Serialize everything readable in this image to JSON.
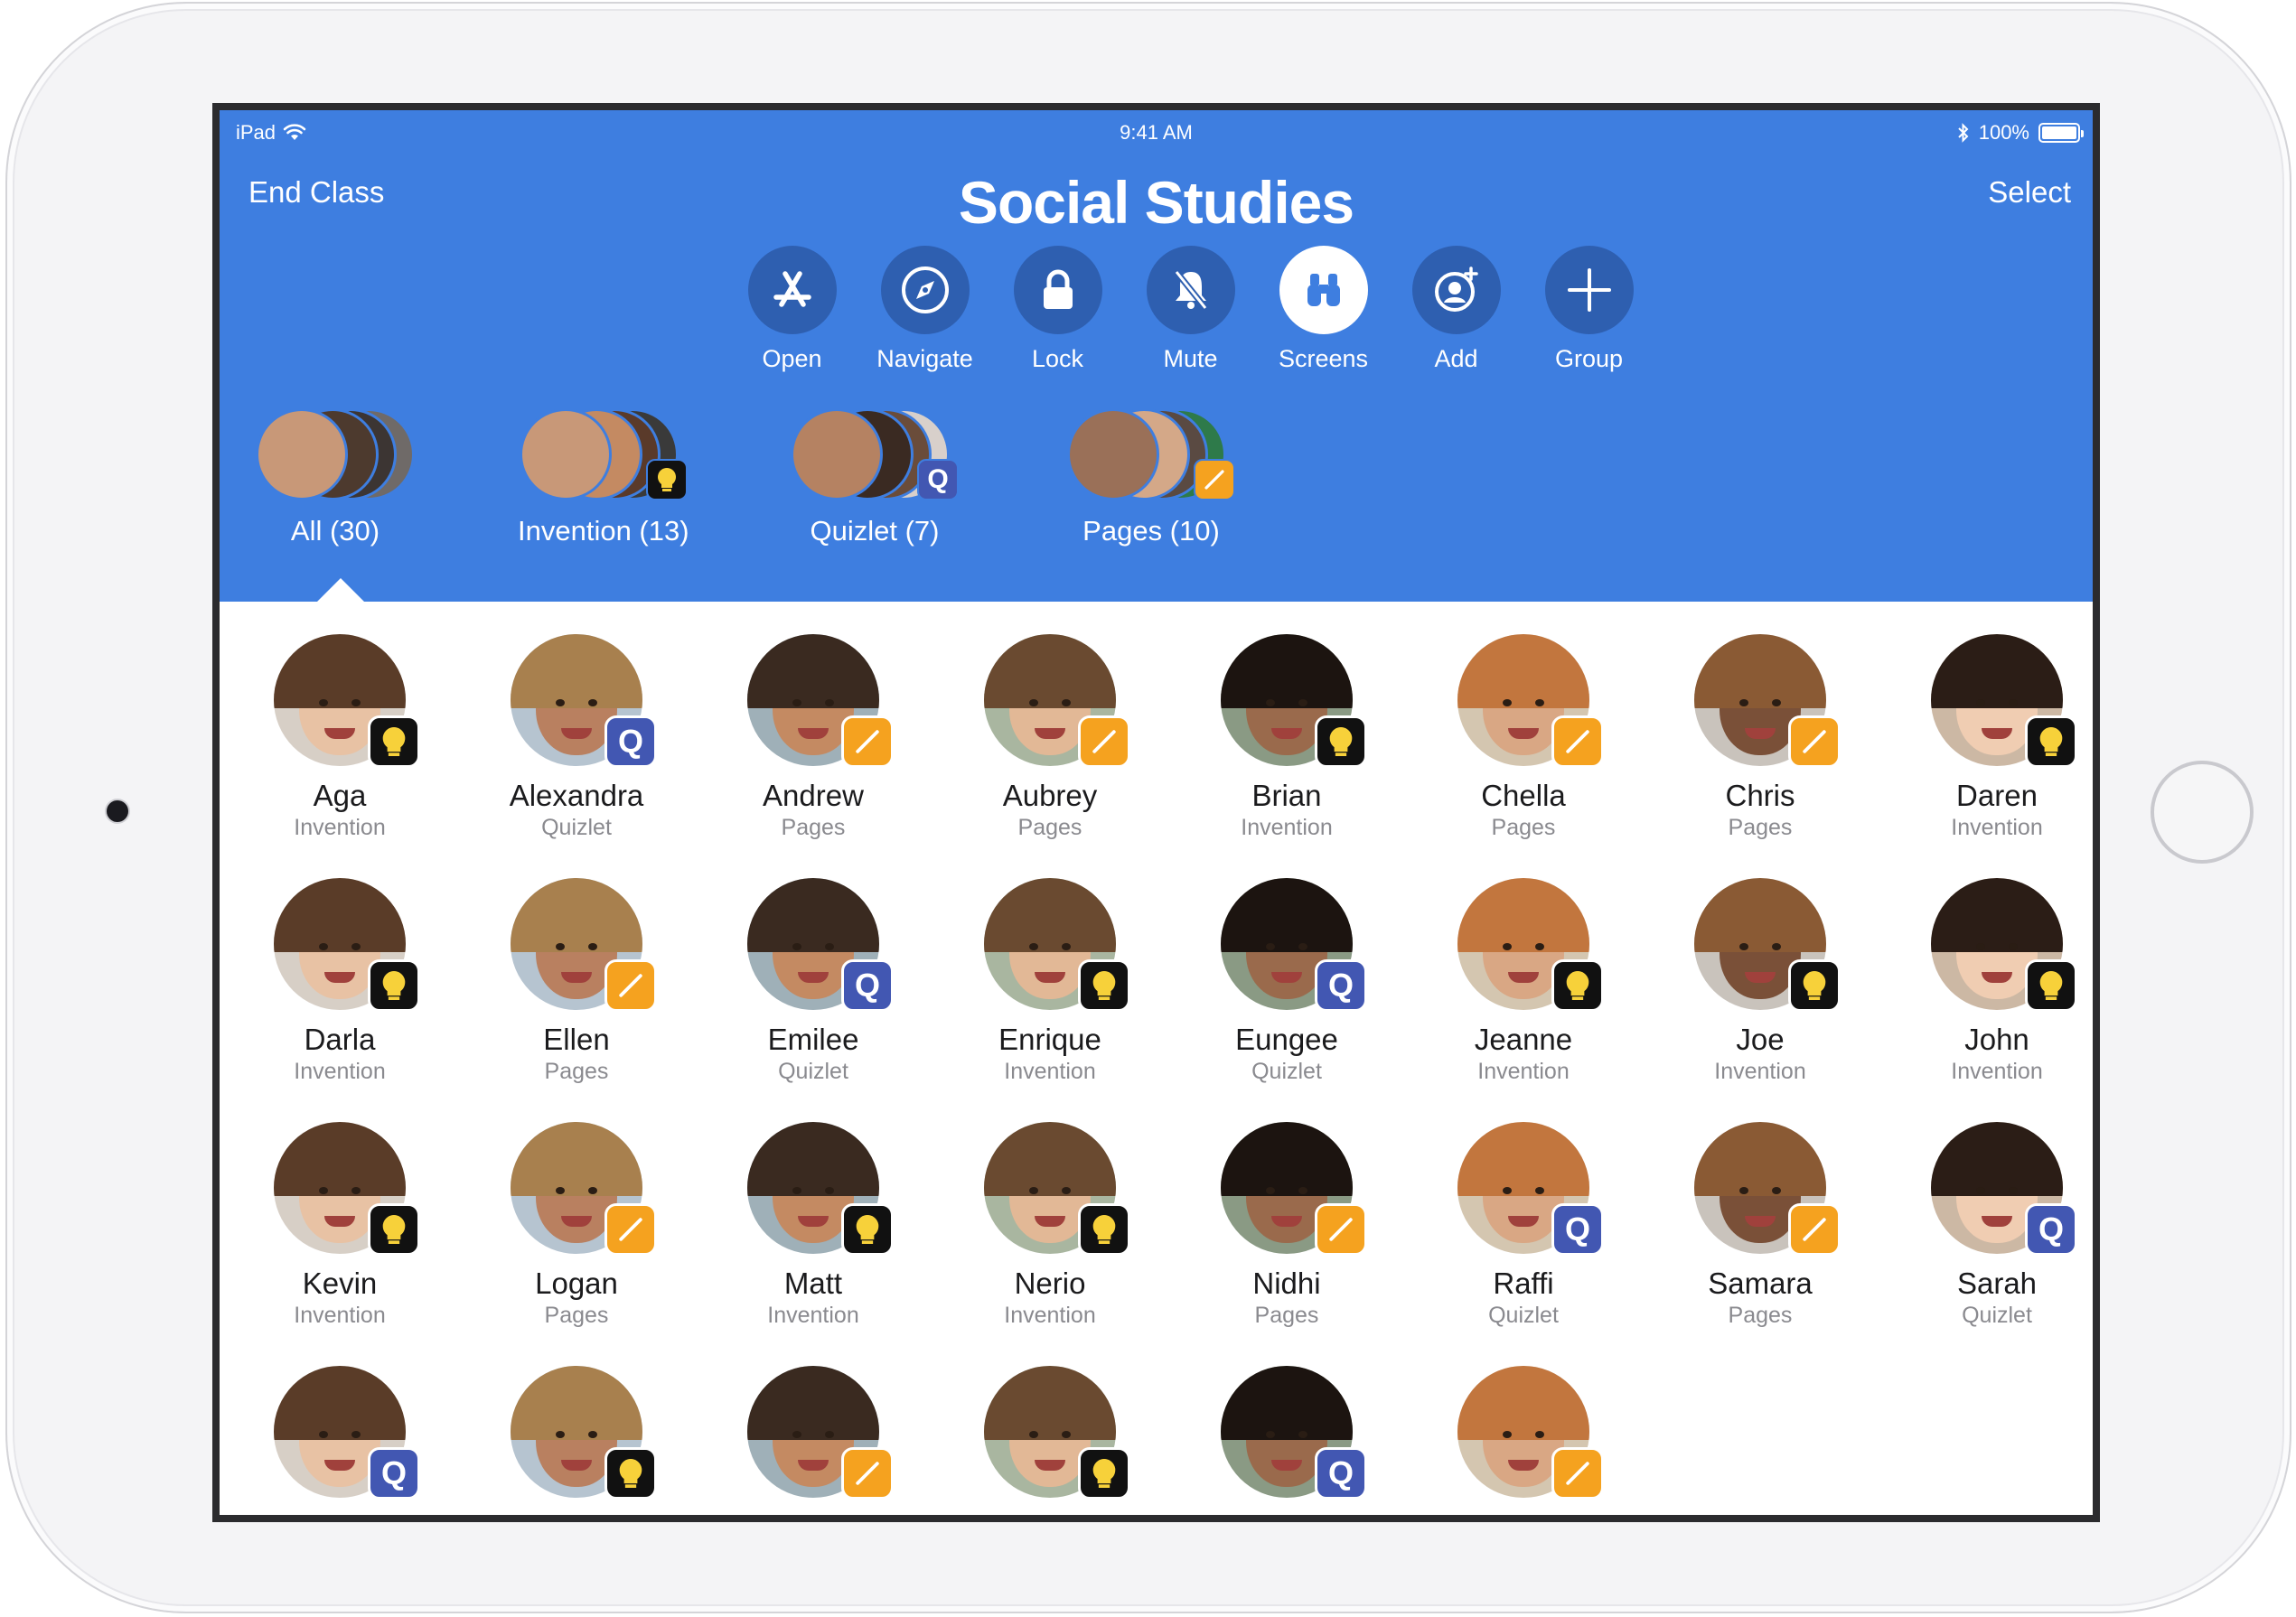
{
  "status_bar": {
    "device": "iPad",
    "time": "9:41 AM",
    "battery": "100%"
  },
  "nav": {
    "left_label": "End Class",
    "title": "Social Studies",
    "right_label": "Select"
  },
  "toolbar": [
    {
      "key": "open",
      "label": "Open",
      "icon": "app-store-icon"
    },
    {
      "key": "navigate",
      "label": "Navigate",
      "icon": "compass-icon"
    },
    {
      "key": "lock",
      "label": "Lock",
      "icon": "lock-icon"
    },
    {
      "key": "mute",
      "label": "Mute",
      "icon": "bell-slash-icon"
    },
    {
      "key": "screens",
      "label": "Screens",
      "icon": "binoculars-icon",
      "active": true
    },
    {
      "key": "add",
      "label": "Add",
      "icon": "person-add-icon"
    },
    {
      "key": "group",
      "label": "Group",
      "icon": "plus-icon"
    }
  ],
  "groups": [
    {
      "label": "All (30)",
      "badge": null,
      "selected": true
    },
    {
      "label": "Invention (13)",
      "badge": "invention"
    },
    {
      "label": "Quizlet (7)",
      "badge": "quizlet"
    },
    {
      "label": "Pages (10)",
      "badge": "pages"
    }
  ],
  "students": [
    {
      "name": "Aga",
      "app": "Invention"
    },
    {
      "name": "Alexandra",
      "app": "Quizlet"
    },
    {
      "name": "Andrew",
      "app": "Pages"
    },
    {
      "name": "Aubrey",
      "app": "Pages"
    },
    {
      "name": "Brian",
      "app": "Invention"
    },
    {
      "name": "Chella",
      "app": "Pages"
    },
    {
      "name": "Chris",
      "app": "Pages"
    },
    {
      "name": "Daren",
      "app": "Invention"
    },
    {
      "name": "Darla",
      "app": "Invention"
    },
    {
      "name": "Ellen",
      "app": "Pages"
    },
    {
      "name": "Emilee",
      "app": "Quizlet"
    },
    {
      "name": "Enrique",
      "app": "Invention"
    },
    {
      "name": "Eungee",
      "app": "Quizlet"
    },
    {
      "name": "Jeanne",
      "app": "Invention"
    },
    {
      "name": "Joe",
      "app": "Invention"
    },
    {
      "name": "John",
      "app": "Invention"
    },
    {
      "name": "Kevin",
      "app": "Invention"
    },
    {
      "name": "Logan",
      "app": "Pages"
    },
    {
      "name": "Matt",
      "app": "Invention"
    },
    {
      "name": "Nerio",
      "app": "Invention"
    },
    {
      "name": "Nidhi",
      "app": "Pages"
    },
    {
      "name": "Raffi",
      "app": "Quizlet"
    },
    {
      "name": "Samara",
      "app": "Pages"
    },
    {
      "name": "Sarah",
      "app": "Quizlet"
    },
    {
      "name": "",
      "app": "",
      "badge": "Quizlet"
    },
    {
      "name": "",
      "app": "",
      "badge": "Invention"
    },
    {
      "name": "",
      "app": "",
      "badge": "Pages"
    },
    {
      "name": "",
      "app": "",
      "badge": "Invention"
    },
    {
      "name": "",
      "app": "",
      "badge": "Quizlet"
    },
    {
      "name": "",
      "app": "",
      "badge": "Pages"
    }
  ],
  "colors": {
    "header_blue": "#3e7ee0",
    "tool_circle": "#2e5fb0",
    "invention_badge": "#111111",
    "quizlet_badge": "#4257b2",
    "pages_badge": "#f5a21f"
  }
}
